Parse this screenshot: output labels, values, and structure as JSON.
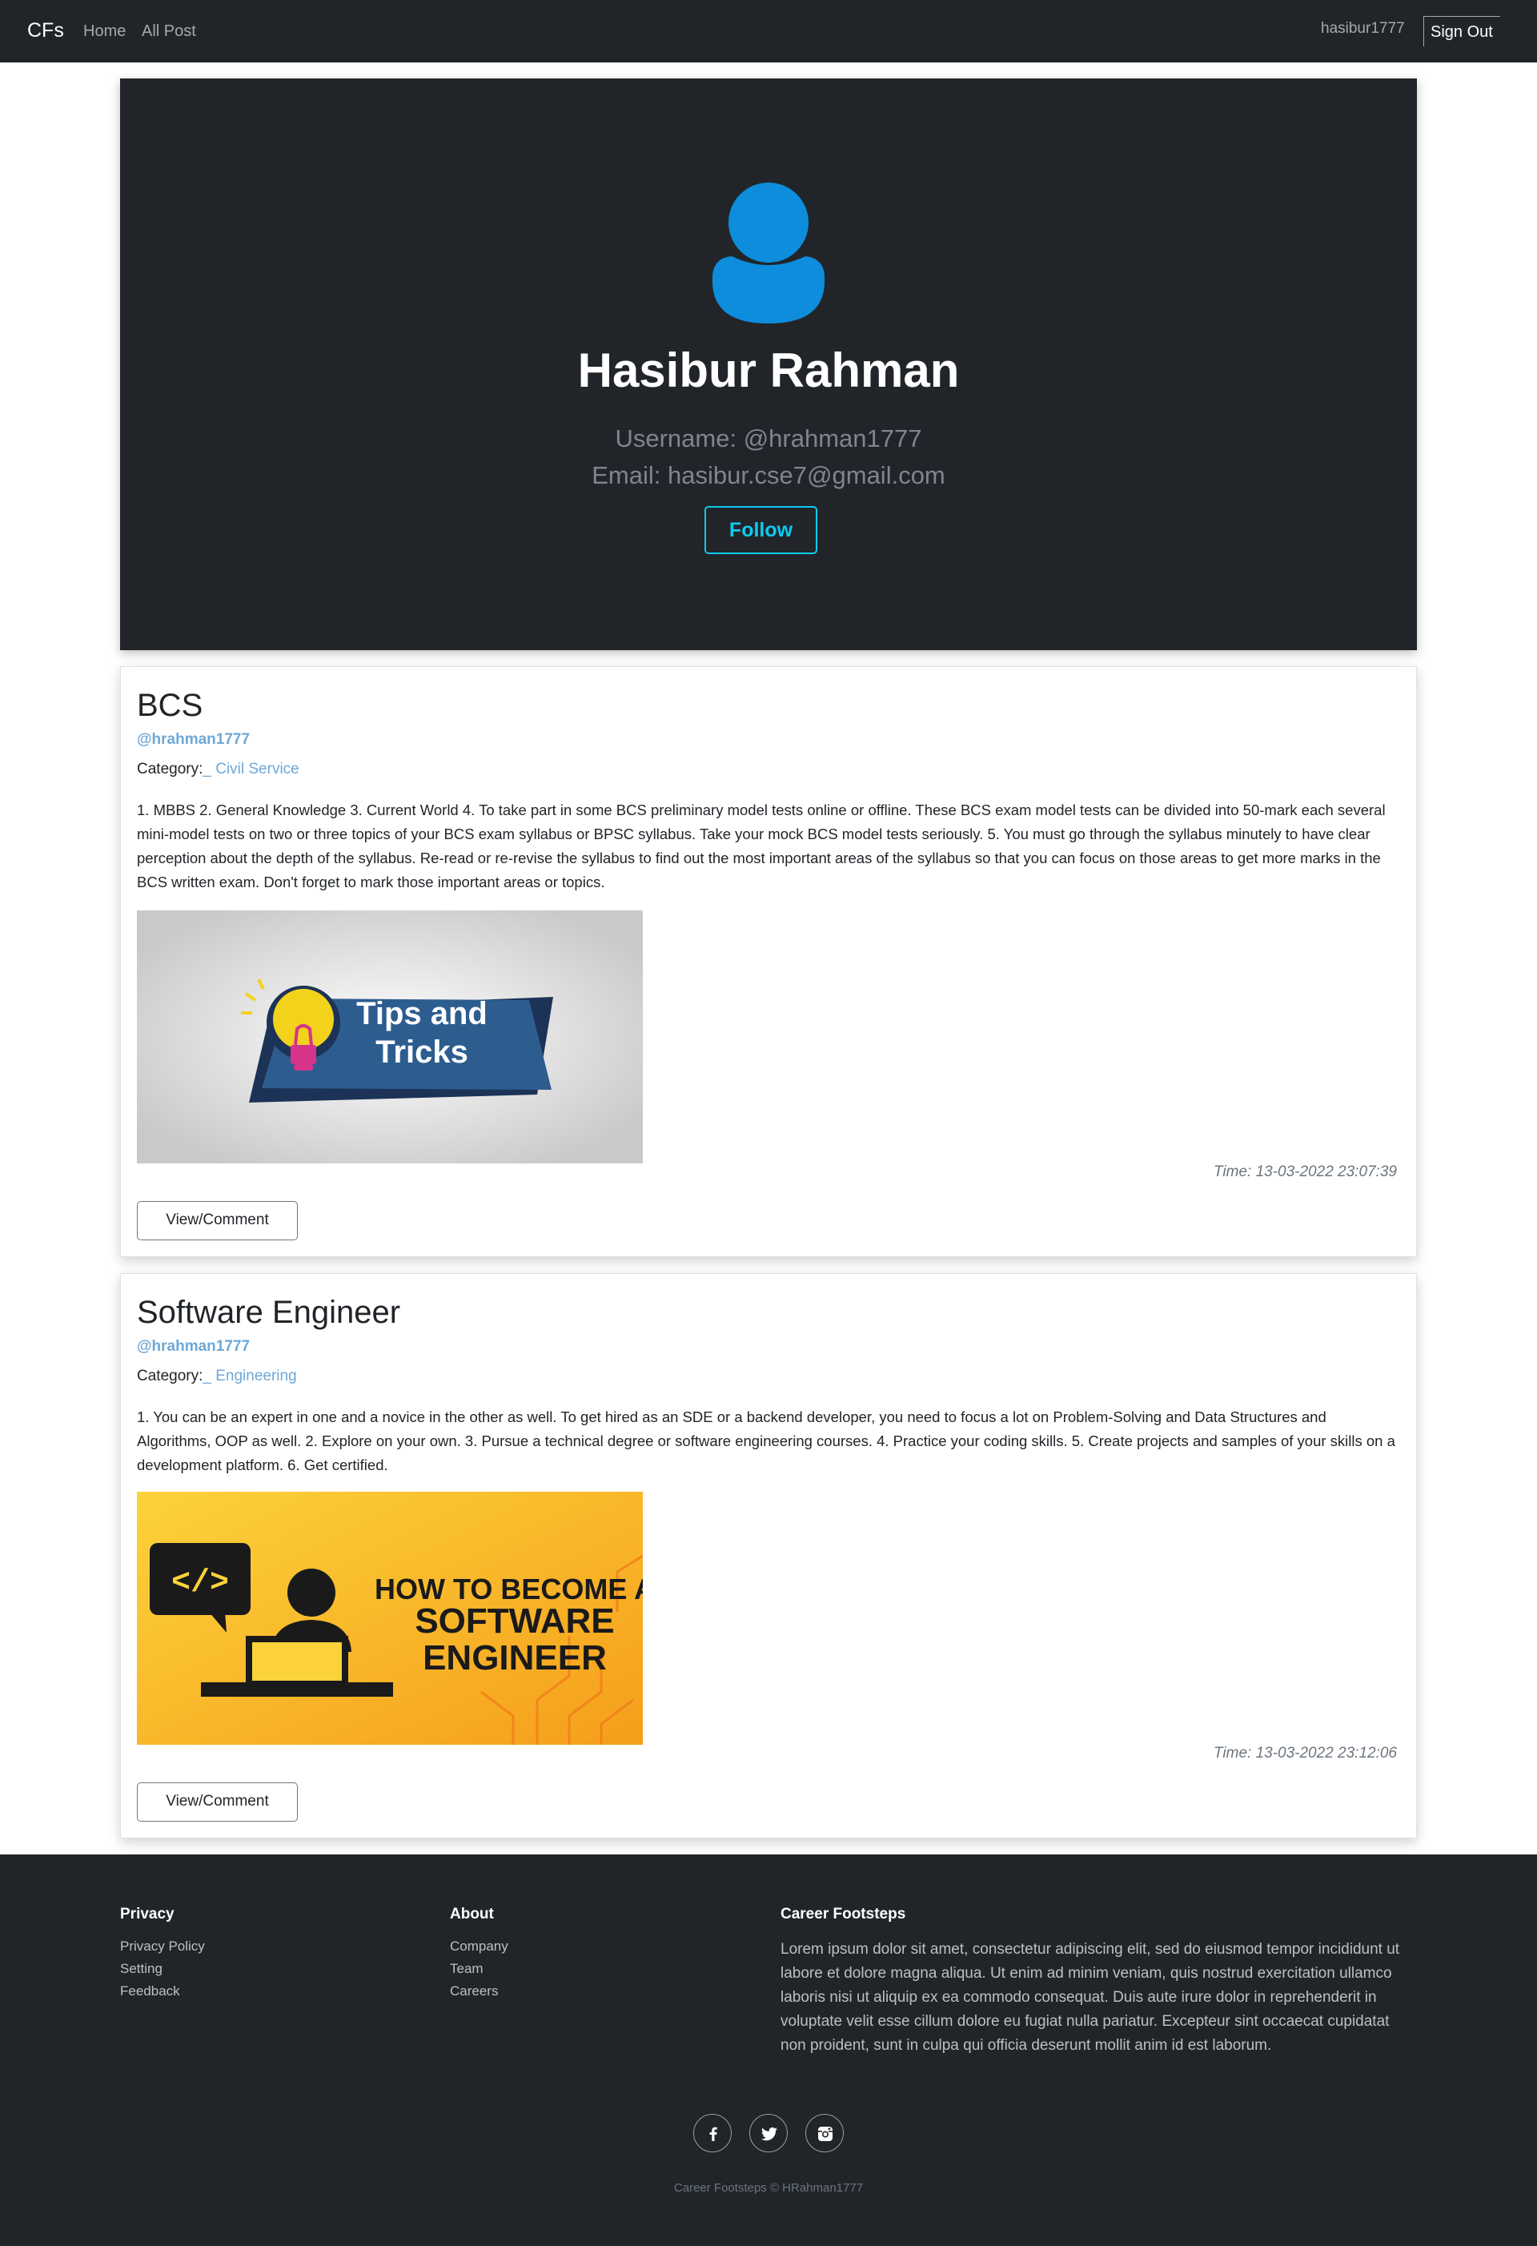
{
  "nav": {
    "brand": "CFs",
    "links": [
      "Home",
      "All Post"
    ],
    "user": "hasibur1777",
    "signout_label": "Sign Out"
  },
  "profile": {
    "name": "Hasibur Rahman",
    "username": "Username: @hrahman1777",
    "email": "Email: hasibur.cse7@gmail.com",
    "follow_label": "Follow"
  },
  "posts": [
    {
      "title": "BCS",
      "author": "@hrahman1777",
      "category_label": "Category:",
      "category": "_ Civil Service",
      "body": "1. MBBS 2. General Knowledge 3. Current World 4. To take part in some BCS preliminary model tests online or offline. These BCS exam model tests can be divided into 50-mark each several mini-model tests on two or three topics of your BCS exam syllabus or BPSC syllabus. Take your mock BCS model tests seriously. 5. You must go through the syllabus minutely to have clear perception about the depth of the syllabus. Re-read or re-revise the syllabus to find out the most important areas of the syllabus so that you can focus on those areas to get more marks in the BCS written exam. Don't forget to mark those important areas or topics.",
      "image_text": [
        "Tips and",
        "Tricks"
      ],
      "time": "Time: 13-03-2022 23:07:39",
      "button_label": "View/Comment"
    },
    {
      "title": "Software Engineer",
      "author": "@hrahman1777",
      "category_label": "Category:",
      "category": "_ Engineering",
      "body": "1. You can be an expert in one and a novice in the other as well. To get hired as an SDE or a backend developer, you need to focus a lot on Problem-Solving and Data Structures and Algorithms, OOP as well. 2. Explore on your own. 3. Pursue a technical degree or software engineering courses. 4. Practice your coding skills. 5. Create projects and samples of your skills on a development platform. 6. Get certified.",
      "image_text": [
        "HOW TO BECOME A",
        "SOFTWARE",
        "ENGINEER"
      ],
      "image_code": "</>",
      "time": "Time: 13-03-2022 23:12:06",
      "button_label": "View/Comment"
    }
  ],
  "footer": {
    "privacy": {
      "title": "Privacy",
      "links": [
        "Privacy Policy",
        "Setting",
        "Feedback"
      ]
    },
    "about": {
      "title": "About",
      "links": [
        "Company",
        "Team",
        "Careers"
      ]
    },
    "career": {
      "title": "Career Footsteps",
      "text": "Lorem ipsum dolor sit amet, consectetur adipiscing elit, sed do eiusmod tempor incididunt ut labore et dolore magna aliqua. Ut enim ad minim veniam, quis nostrud exercitation ullamco laboris nisi ut aliquip ex ea commodo consequat. Duis aute irure dolor in reprehenderit in voluptate velit esse cillum dolore eu fugiat nulla pariatur. Excepteur sint occaecat cupidatat non proident, sunt in culpa qui officia deserunt mollit anim id est laborum."
    },
    "social": [
      "facebook-icon",
      "twitter-icon",
      "instagram-icon"
    ],
    "copyright": "Career Footsteps © HRahman1777"
  },
  "colors": {
    "dark": "#212529",
    "accent": "#0dcaf0",
    "avatar": "#0d8ddb",
    "link": "#6ea8d8"
  }
}
